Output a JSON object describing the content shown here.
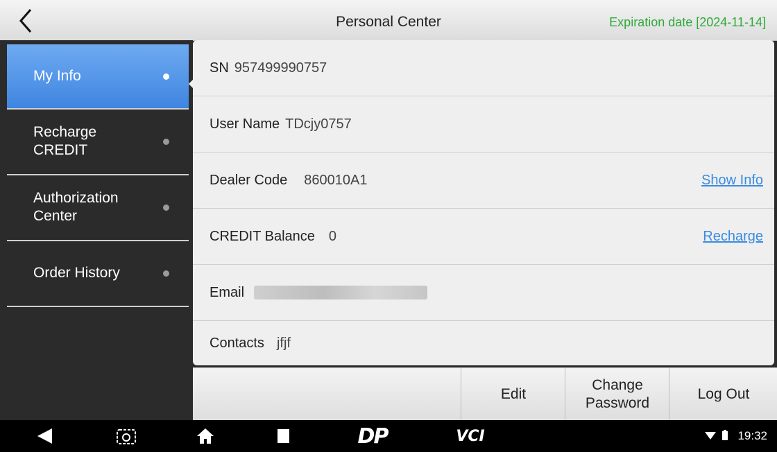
{
  "header": {
    "title": "Personal Center",
    "expiration": "Expiration date [2024-11-14]"
  },
  "sidebar": {
    "items": [
      {
        "label": "My Info",
        "active": true
      },
      {
        "label": "Recharge CREDIT",
        "active": false
      },
      {
        "label": "Authorization Center",
        "active": false
      },
      {
        "label": "Order History",
        "active": false
      }
    ]
  },
  "info": {
    "sn_label": "SN",
    "sn_value": "957499990757",
    "username_label": "User Name",
    "username_value": "TDcjy0757",
    "dealer_label": "Dealer Code",
    "dealer_value": "860010A1",
    "dealer_link": "Show Info",
    "credit_label": "CREDIT Balance",
    "credit_value": "0",
    "credit_link": "Recharge",
    "email_label": "Email",
    "contacts_label": "Contacts",
    "contacts_value": "jfjf"
  },
  "actions": {
    "edit": "Edit",
    "change_password_line1": "Change",
    "change_password_line2": "Password",
    "logout": "Log Out"
  },
  "navbar": {
    "brand_dp": "DP",
    "brand_vci": "VCI",
    "time": "19:32"
  },
  "colors": {
    "accent": "#3f85e0",
    "expiration": "#2eaa3a",
    "link": "#3a8be0"
  }
}
